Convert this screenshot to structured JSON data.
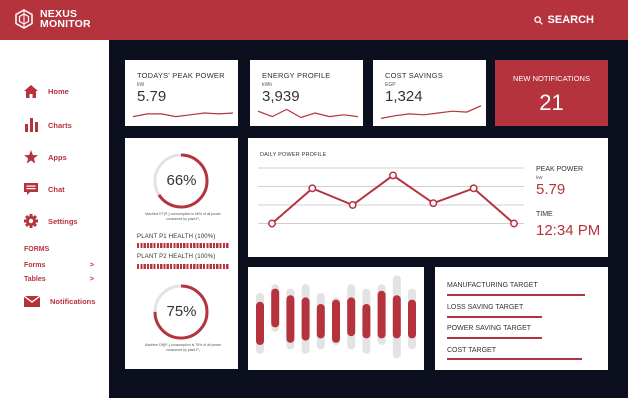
{
  "app": {
    "name_line1": "NEXUS",
    "name_line2": "MONITOR"
  },
  "header": {
    "search_label": "SEARCH"
  },
  "sidebar": {
    "items": [
      {
        "label": "Home",
        "icon": "home-icon"
      },
      {
        "label": "Charts",
        "icon": "bar-chart-icon"
      },
      {
        "label": "Apps",
        "icon": "star-icon"
      },
      {
        "label": "Chat",
        "icon": "chat-icon"
      },
      {
        "label": "Settings",
        "icon": "gear-icon"
      }
    ],
    "forms_heading": "FORMS",
    "sub_items": [
      {
        "label": "Forms",
        "arrow": ">"
      },
      {
        "label": "Tables",
        "arrow": ">"
      }
    ],
    "notifications": {
      "label": "Notifications",
      "icon": "mail-icon"
    }
  },
  "kpis": [
    {
      "title": "TODAYS' PEAK POWER",
      "unit": "kW",
      "value": "5.79"
    },
    {
      "title": "ENERGY PROFILE",
      "unit": "kWh",
      "value": "3,939"
    },
    {
      "title": "COST SAVINGS",
      "unit": "EGP",
      "value": "1,324"
    }
  ],
  "notifications": {
    "title": "NEW NOTIFICATIONS",
    "count": "21"
  },
  "gauges": [
    {
      "label": "66%",
      "percent": 66,
      "caption": "Machine KT(P₁) consumption is 66% of all power consumed by plant P₁"
    },
    {
      "label": "75%",
      "percent": 75,
      "caption": "Machine DB(P₂) consumption is 75% of all power consumed by plant P₂"
    }
  ],
  "plant_health": [
    {
      "label": "PLANT P1 HEALTH (100%)",
      "value": 100
    },
    {
      "label": "PLANT P2 HEALTH (100%)",
      "value": 100
    }
  ],
  "daily_profile": {
    "title": "DAILY POWER PROFILE",
    "peak_label": "PEAK POWER",
    "peak_unit": "kW",
    "peak_value": "5.79",
    "time_label": "TIME",
    "time_value": "12:34 PM"
  },
  "targets": [
    {
      "label": "MANUFACTURING TARGET",
      "fill": 1.0
    },
    {
      "label": "LOSS SAVING TARGET",
      "fill": 0.69
    },
    {
      "label": "POWER SAVING TARGET",
      "fill": 0.69
    },
    {
      "label": "COST TARGET",
      "fill": 0.98
    }
  ],
  "colors": {
    "accent": "#b5333d",
    "background": "#0b0f1e",
    "card": "#ffffff",
    "track": "#e3e3e3"
  },
  "chart_data": [
    {
      "type": "line",
      "title": "DAILY POWER PROFILE",
      "x": [
        1,
        2,
        3,
        4,
        5,
        6,
        7,
        8
      ],
      "series": [
        {
          "values": [
            1.0,
            2.9,
            2.0,
            3.6,
            2.1,
            2.9,
            1.0
          ]
        }
      ],
      "ylim": [
        0,
        4
      ],
      "grid": true
    },
    {
      "type": "bar",
      "series": [
        {
          "values": [
            0.4,
            0.35,
            0.45,
            0.4,
            0.3,
            0.4,
            0.35,
            0.3,
            0.45,
            0.4,
            0.35
          ]
        }
      ],
      "ranges": [
        [
          0.15,
          0.75
        ],
        [
          0.4,
          0.85
        ],
        [
          0.2,
          0.8
        ],
        [
          0.15,
          0.85
        ],
        [
          0.2,
          0.75
        ],
        [
          0.25,
          0.7
        ],
        [
          0.2,
          0.85
        ],
        [
          0.15,
          0.8
        ],
        [
          0.25,
          0.85
        ],
        [
          0.1,
          0.95
        ],
        [
          0.2,
          0.8
        ]
      ]
    },
    {
      "type": "line",
      "title": "sparklines",
      "series": [
        {
          "name": "",
          "values": [
            0.3,
            0.45,
            0.45,
            0.3,
            0.4,
            0.5,
            0.45,
            0.5
          ]
        },
        {
          "name": "",
          "values": [
            0.6,
            0.3,
            0.7,
            0.25,
            0.5,
            0.3,
            0.4,
            0.3
          ]
        },
        {
          "name": "",
          "values": [
            0.2,
            0.35,
            0.45,
            0.4,
            0.5,
            0.6,
            0.55,
            0.9
          ]
        }
      ]
    }
  ]
}
